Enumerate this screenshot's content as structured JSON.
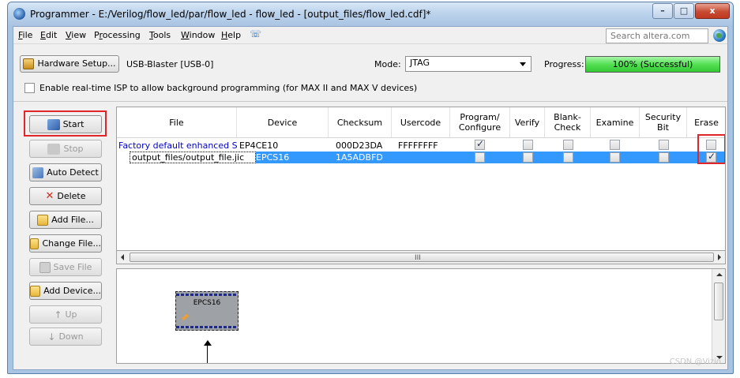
{
  "window": {
    "title": "Programmer - E:/Verilog/flow_led/par/flow_led - flow_led - [output_files/flow_led.cdf]*",
    "controls": {
      "minimize": "–",
      "maximize": "□",
      "close": "x"
    }
  },
  "menu": {
    "items": [
      {
        "u": "F",
        "rest": "ile"
      },
      {
        "u": "E",
        "rest": "dit"
      },
      {
        "u": "V",
        "rest": "iew"
      },
      {
        "pre": "P",
        "u": "r",
        "rest": "ocessing"
      },
      {
        "u": "T",
        "rest": "ools"
      },
      {
        "u": "W",
        "rest": "indow"
      },
      {
        "u": "H",
        "rest": "elp"
      }
    ],
    "search_placeholder": "Search altera.com"
  },
  "hardware": {
    "setup_label": "Hardware Setup...",
    "device_label": "USB-Blaster [USB-0]"
  },
  "mode": {
    "label": "Mode:",
    "value": "JTAG"
  },
  "progress": {
    "label": "Progress:",
    "value": 1.0,
    "text": "100% (Successful)"
  },
  "isp": {
    "label": "Enable real-time ISP to allow background programming (for MAX II and MAX V devices)",
    "checked": false
  },
  "sidebar": {
    "start": "Start",
    "stop": "Stop",
    "auto_detect": "Auto Detect",
    "delete": "Delete",
    "add_file": "Add File...",
    "change_file": "Change File...",
    "save_file": "Save File",
    "add_device": "Add Device...",
    "up": "Up",
    "down": "Down"
  },
  "table": {
    "headers": [
      "File",
      "Device",
      "Checksum",
      "Usercode",
      "Program/\nConfigure",
      "Verify",
      "Blank-\nCheck",
      "Examine",
      "Security\nBit",
      "Erase"
    ],
    "rows": [
      {
        "file": "Factory default enhanced S...",
        "device": "EP4CE10",
        "checksum": "000D23DA",
        "usercode": "FFFFFFFF",
        "program": true,
        "verify": false,
        "blank": false,
        "examine": false,
        "security": false,
        "erase": false,
        "selected": false
      },
      {
        "file": "output_files/output_file.jic",
        "device": "EPCS16",
        "checksum": "1A5ADBFD",
        "usercode": "",
        "program": false,
        "verify": false,
        "blank": false,
        "examine": false,
        "security": false,
        "erase": true,
        "selected": true
      }
    ],
    "scroll_grip": "III"
  },
  "diagram": {
    "chip_label": "EPCS16"
  },
  "watermark": "CSDN @Vizio"
}
